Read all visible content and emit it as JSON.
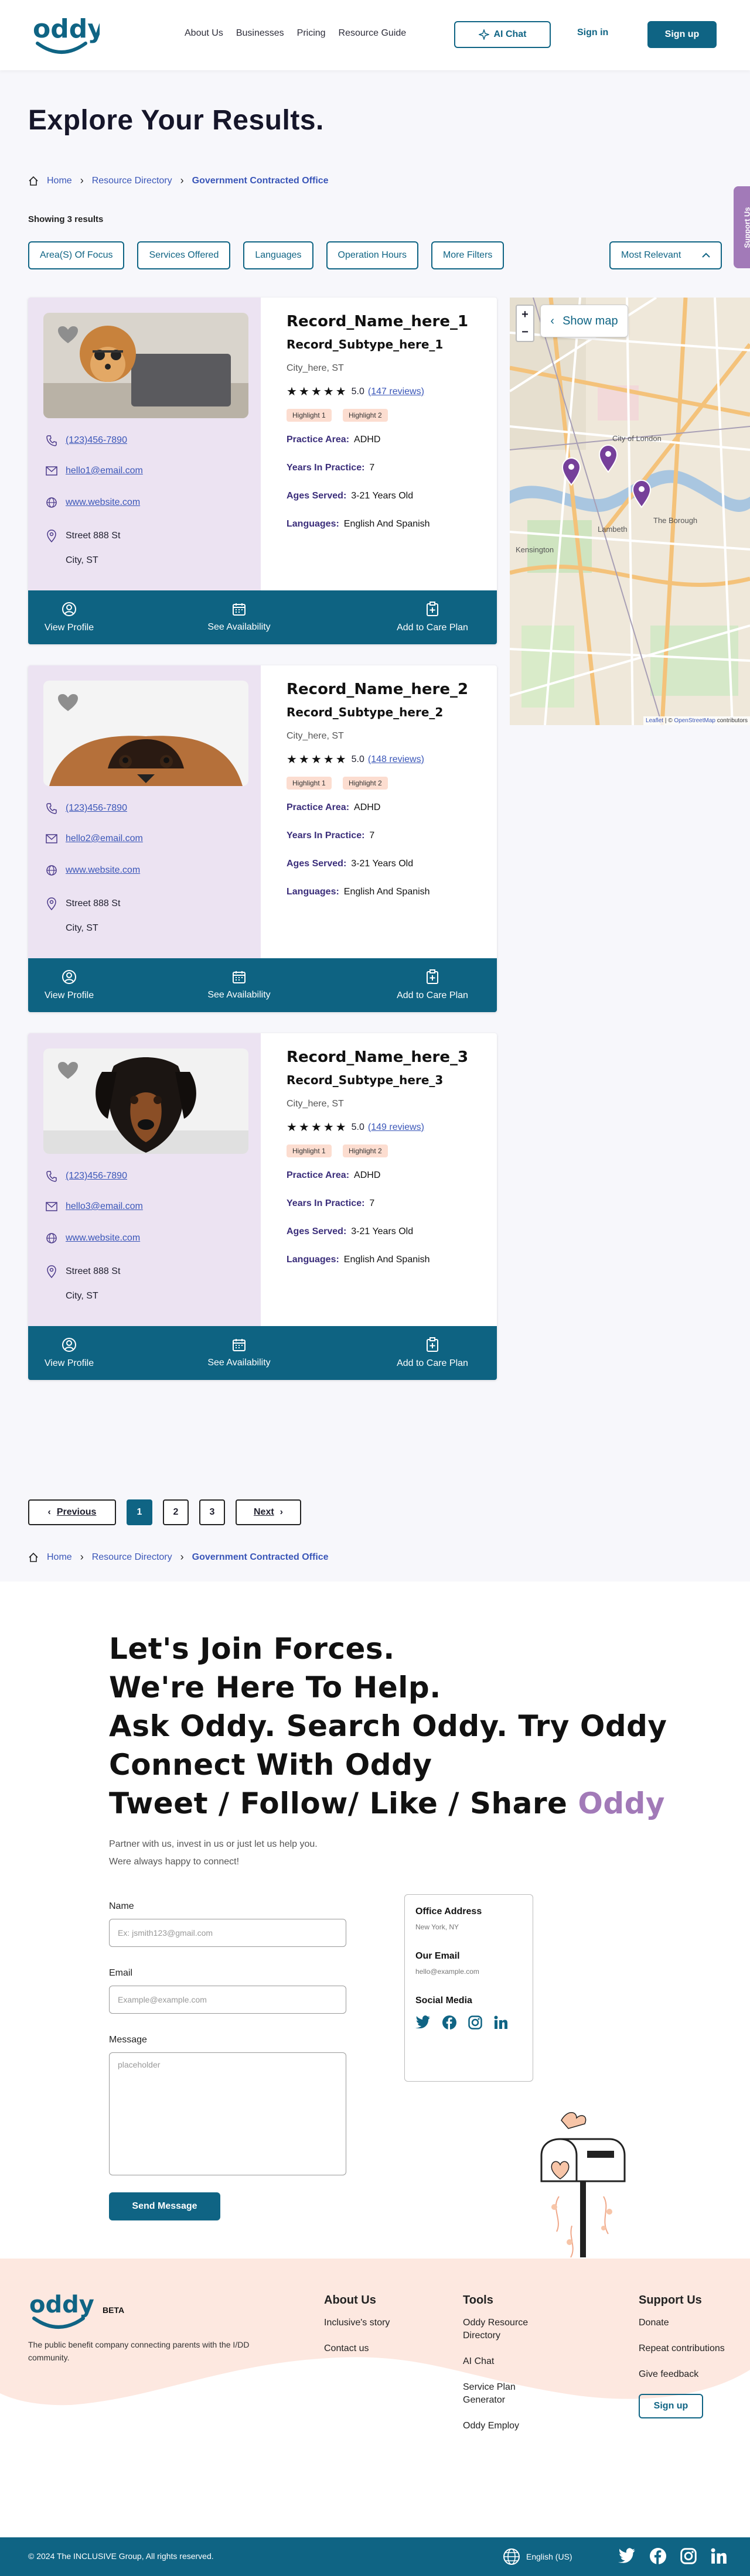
{
  "header": {
    "logo": "oddy",
    "nav": [
      "About Us",
      "Businesses",
      "Pricing",
      "Resource Guide"
    ],
    "ai_chat": "AI Chat",
    "sign_in": "Sign in",
    "sign_up": "Sign up",
    "support_tab": "Support Us"
  },
  "page_title": "Explore Your Results.",
  "breadcrumb": [
    "Home",
    "Resource Directory",
    "Government Contracted Office"
  ],
  "showing": "Showing 3 results",
  "filters": [
    "Area(S) Of Focus",
    "Services Offered",
    "Languages",
    "Operation Hours",
    "More Filters"
  ],
  "sort": "Most Relevant",
  "labels": {
    "practice_area": "Practice Area:",
    "years": "Years In Practice:",
    "ages": "Ages Served:",
    "languages": "Languages:",
    "view_profile": "View Profile",
    "see_availability": "See Availability",
    "add_care_plan": "Add to Care Plan"
  },
  "results": [
    {
      "name": "Record_Name_here_1",
      "subtype": "Record_Subtype_here_1",
      "city": "City_here, ST",
      "rating": "5.0",
      "reviews": "(147 reviews)",
      "highlights": [
        "Highlight 1",
        "Highlight 2"
      ],
      "practice_area": "ADHD",
      "years": "7",
      "ages": "3-21 Years Old",
      "languages": "English And Spanish",
      "phone": "(123)456-7890",
      "email": "hello1@email.com",
      "website": "www.website.com",
      "street": "Street 888 St",
      "city_line": "City, ST"
    },
    {
      "name": "Record_Name_here_2",
      "subtype": "Record_Subtype_here_2",
      "city": "City_here, ST",
      "rating": "5.0",
      "reviews": "(148 reviews)",
      "highlights": [
        "Highlight 1",
        "Highlight 2"
      ],
      "practice_area": "ADHD",
      "years": "7",
      "ages": "3-21 Years Old",
      "languages": "English And Spanish",
      "phone": "(123)456-7890",
      "email": "hello2@email.com",
      "website": "www.website.com",
      "street": "Street 888 St",
      "city_line": "City, ST"
    },
    {
      "name": "Record_Name_here_3",
      "subtype": "Record_Subtype_here_3",
      "city": "City_here, ST",
      "rating": "5.0",
      "reviews": "(149 reviews)",
      "highlights": [
        "Highlight 1",
        "Highlight 2"
      ],
      "practice_area": "ADHD",
      "years": "7",
      "ages": "3-21 Years Old",
      "languages": "English And Spanish",
      "phone": "(123)456-7890",
      "email": "hello3@email.com",
      "website": "www.website.com",
      "street": "Street 888 St",
      "city_line": "City, ST"
    }
  ],
  "map": {
    "show_map": "Show map",
    "zoom_in": "+",
    "zoom_out": "−",
    "attribution_leaflet": "Leaflet",
    "attribution_sep": " | © ",
    "attribution_osm": "OpenStreetMap",
    "attribution_tail": " contributors",
    "labels": [
      "City of London",
      "The Borough",
      "Kensington",
      "Lambeth"
    ]
  },
  "pagination": {
    "previous": "Previous",
    "pages": [
      "1",
      "2",
      "3"
    ],
    "active": "1",
    "next": "Next"
  },
  "join": {
    "lines": [
      "Let's Join Forces.",
      "We're Here To Help.",
      "Ask Oddy. Search Oddy. Try Oddy",
      "Connect With Oddy"
    ],
    "last_line": "Tweet / Follow/ Like / Share",
    "last_brand": "Oddy",
    "sub1": "Partner with us, invest in us or just let us help you.",
    "sub2": "Were always happy to connect!",
    "name_label": "Name",
    "name_placeholder": "Ex: jsmith123@gmail.com",
    "email_label": "Email",
    "email_placeholder": "Example@example.com",
    "message_label": "Message",
    "message_placeholder": "placeholder",
    "send": "Send Message",
    "office_title": "Office Address",
    "office_value": "New York, NY",
    "email_title": "Our Email",
    "email_value": "hello@example.com",
    "social_title": "Social Media"
  },
  "footer": {
    "beta": "BETA",
    "tagline": "The public benefit company connecting parents with the I/DD community.",
    "about": {
      "title": "About Us",
      "links": [
        "Inclusive's story",
        "Contact us"
      ]
    },
    "tools": {
      "title": "Tools",
      "links": [
        "Oddy Resource Directory",
        "AI Chat",
        "Service Plan Generator",
        "Oddy Employ"
      ]
    },
    "support": {
      "title": "Support Us",
      "links": [
        "Donate",
        "Repeat contributions",
        "Give feedback"
      ],
      "signup": "Sign up"
    },
    "copyright": "© 2024 The INCLUSIVE Group, All rights reserved.",
    "language": "English (US)"
  },
  "colors": {
    "primary": "#0f6484",
    "accent": "#a27ab8",
    "card_left": "#ece3f2",
    "highlight": "#fcddd0"
  }
}
